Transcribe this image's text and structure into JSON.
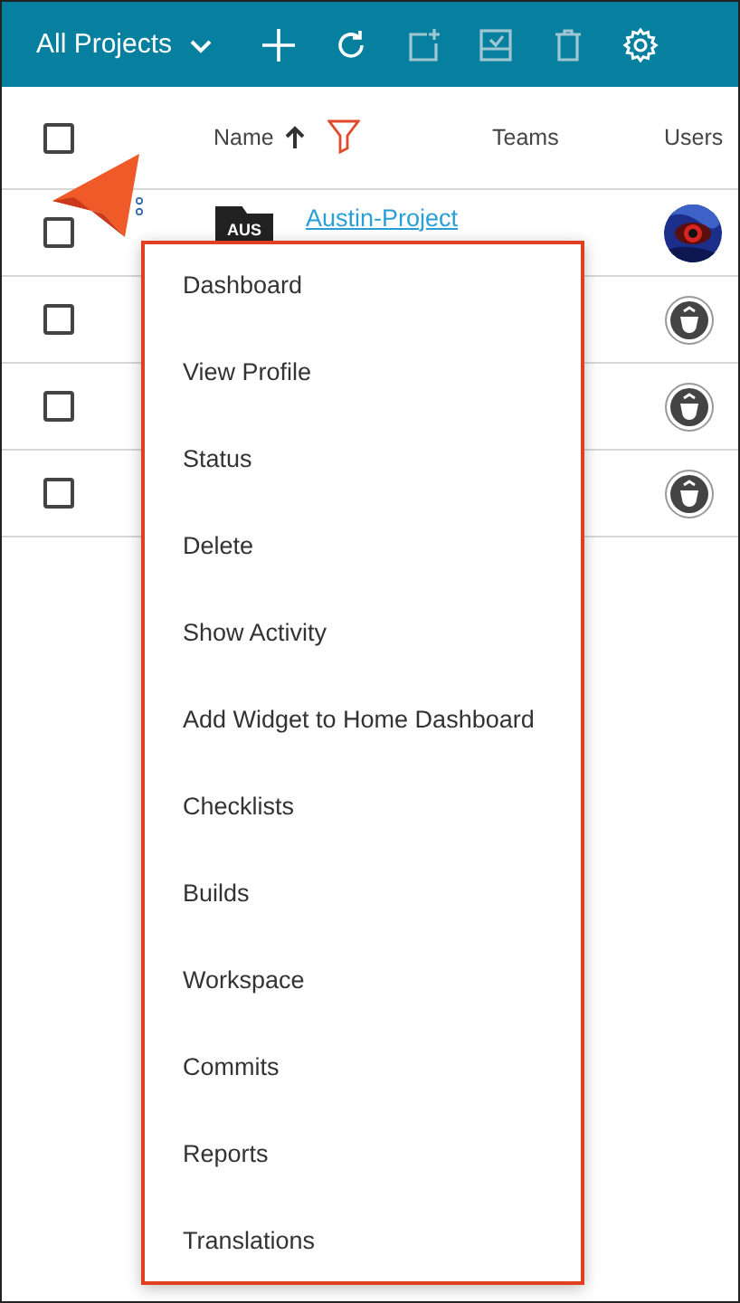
{
  "toolbar": {
    "title": "All Projects",
    "actions": [
      {
        "kind": "plus",
        "disabled": false
      },
      {
        "kind": "refresh",
        "disabled": false
      },
      {
        "kind": "add-square",
        "disabled": true
      },
      {
        "kind": "checklist",
        "disabled": true
      },
      {
        "kind": "trash",
        "disabled": true
      },
      {
        "kind": "gear",
        "disabled": false
      }
    ]
  },
  "table": {
    "select_all": {
      "checked": false
    },
    "columns": [
      {
        "label": "Name",
        "sorted": true,
        "filter": true
      },
      {
        "label": "Teams"
      },
      {
        "label": "Users"
      }
    ],
    "rows": [
      {
        "checked": false,
        "folder_label": "AUS",
        "name": "Austin-Project"
      },
      {
        "checked": false,
        "avatar": {
          "kind": "default"
        }
      },
      {
        "checked": false,
        "avatar": {
          "kind": "default"
        }
      },
      {
        "checked": false,
        "avatar": {
          "kind": "default"
        }
      }
    ]
  },
  "context_menu": {
    "items": [
      "Dashboard",
      "View Profile",
      "Status",
      "Delete",
      "Show Activity",
      "Add Widget to Home Dashboard",
      "Checklists",
      "Builds",
      "Workspace",
      "Commits",
      "Reports",
      "Translations"
    ]
  }
}
